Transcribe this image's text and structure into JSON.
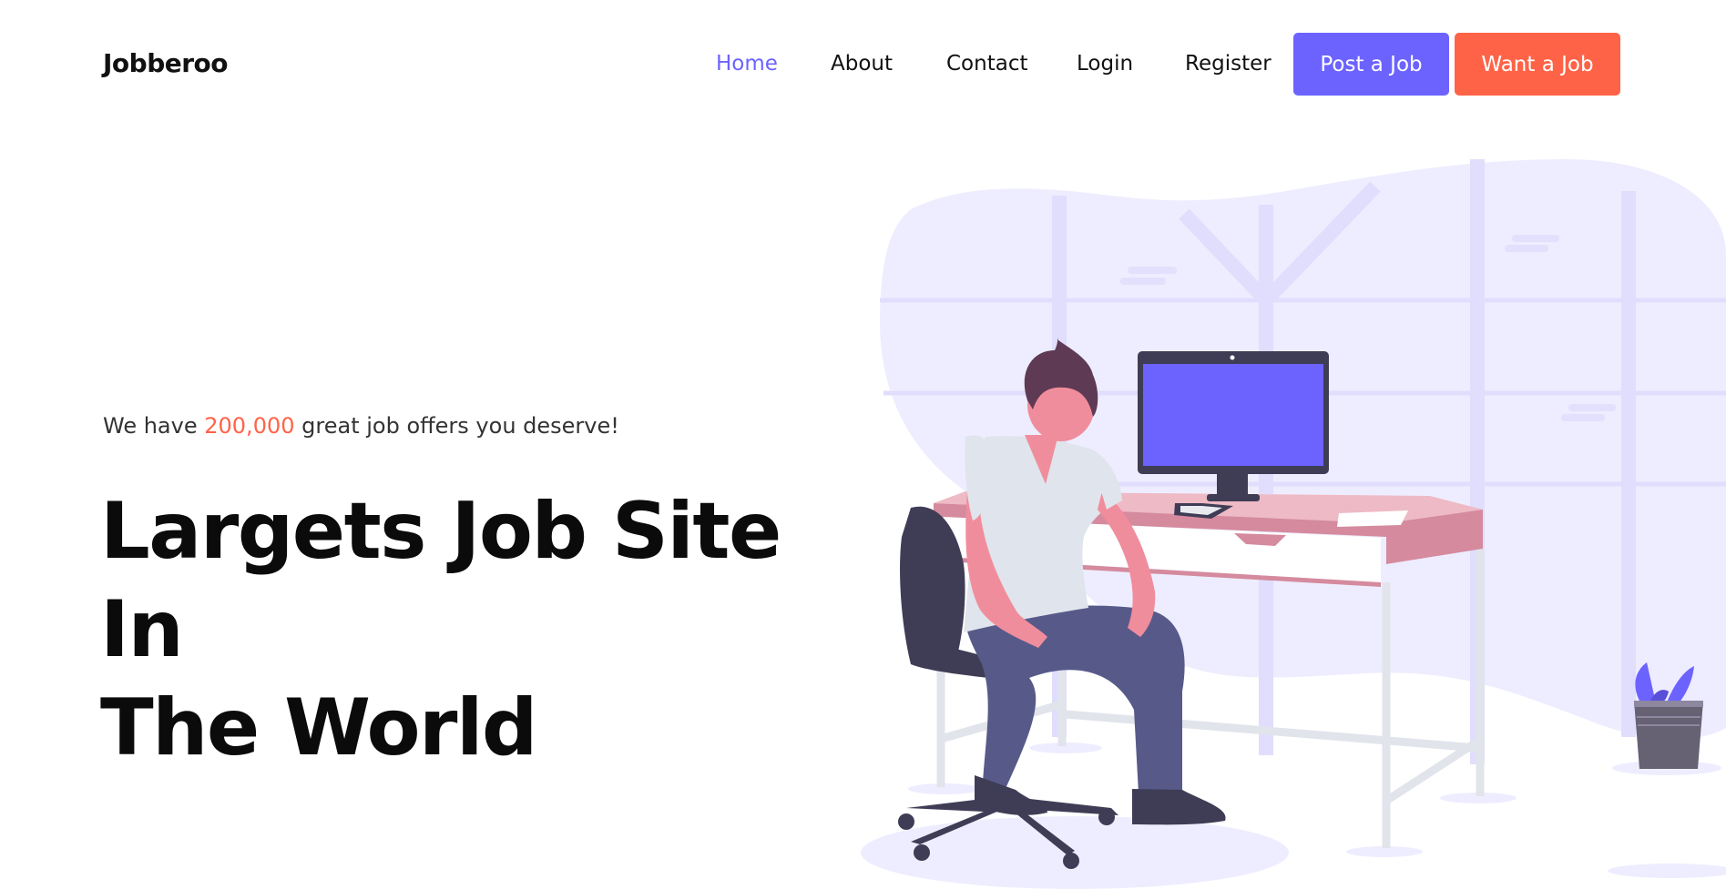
{
  "header": {
    "brand": "Jobberoo",
    "nav": [
      {
        "label": "Home",
        "active": true
      },
      {
        "label": "About",
        "active": false
      },
      {
        "label": "Contact",
        "active": false
      },
      {
        "label": "Login",
        "active": false
      },
      {
        "label": "Register",
        "active": false
      }
    ],
    "post_job_label": "Post a Job",
    "want_job_label": "Want a Job"
  },
  "hero": {
    "tagline_prefix": "We have",
    "tagline_count": "200,000",
    "tagline_suffix": "great job offers you deserve!",
    "title_line1": "Largets Job Site In",
    "title_line2": "The World"
  },
  "illustration": {
    "description_icon": "person-at-desk-illustration"
  },
  "colors": {
    "accent_purple": "#6c63ff",
    "accent_orange": "#ff6347",
    "text_dark": "#111111"
  }
}
